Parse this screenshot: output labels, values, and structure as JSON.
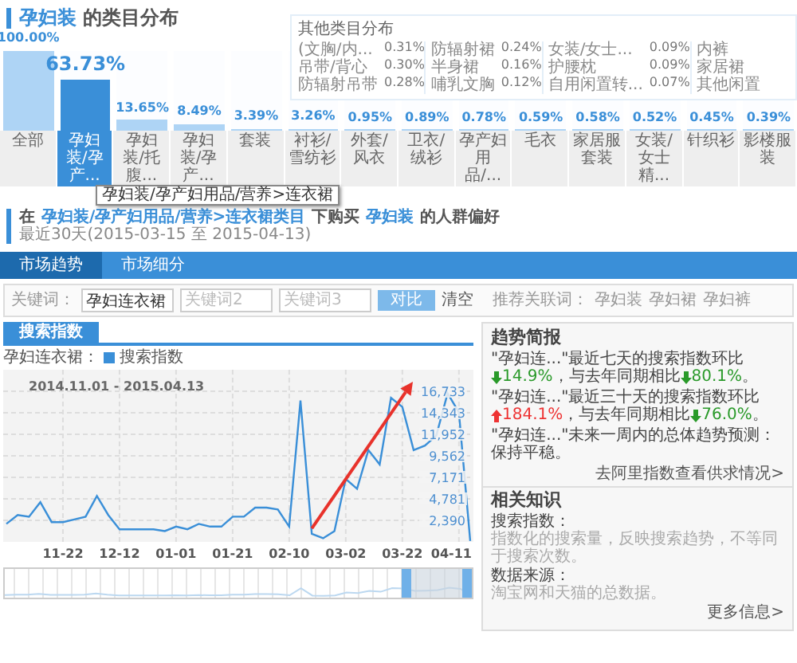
{
  "category_distribution": {
    "title_highlight": "孕妇装",
    "title_rest": "的类目分布",
    "other_categories": {
      "title": "其他类目分布",
      "columns": [
        {
          "items": [
            {
              "label": "(文胸/内...",
              "value": "0.31%"
            },
            {
              "label": "吊带/背心",
              "value": "0.30%"
            },
            {
              "label": "防辐射吊带",
              "value": "0.28%"
            }
          ]
        },
        {
          "items": [
            {
              "label": "防辐射裙",
              "value": "0.24%"
            },
            {
              "label": "半身裙",
              "value": "0.16%"
            },
            {
              "label": "哺乳文胸",
              "value": "0.12%"
            }
          ]
        },
        {
          "items": [
            {
              "label": "女装/女士...",
              "value": "0.09%"
            },
            {
              "label": "护腰枕",
              "value": "0.09%"
            },
            {
              "label": "自用闲置转...",
              "value": "0.07%"
            }
          ]
        },
        {
          "items": [
            {
              "label": "内裤"
            },
            {
              "label": "家居裙"
            },
            {
              "label": "其他闲置"
            }
          ]
        }
      ]
    },
    "bars": [
      {
        "value": "100.00%",
        "level": 1,
        "label": "全部",
        "selected": false
      },
      {
        "value": "63.73%",
        "level": 0.6373,
        "label": "孕妇装/孕产...",
        "selected": true
      },
      {
        "value": "13.65%",
        "level": 0.1365,
        "label": "孕妇装/托腹...",
        "selected": false
      },
      {
        "value": "8.49%",
        "level": 0.0849,
        "label": "孕妇装/孕产...",
        "selected": false
      },
      {
        "value": "3.39%",
        "level": 0.0339,
        "label": "套装",
        "selected": false
      },
      {
        "value": "3.26%",
        "level": 0.0326,
        "label": "衬衫/雪纺衫",
        "selected": false
      },
      {
        "value": "0.95%",
        "level": 0.0095,
        "label": "外套/风衣",
        "selected": false
      },
      {
        "value": "0.89%",
        "level": 0.0089,
        "label": "卫衣/绒衫",
        "selected": false
      },
      {
        "value": "0.78%",
        "level": 0.0078,
        "label": "孕产妇用品/...",
        "selected": false
      },
      {
        "value": "0.59%",
        "level": 0.0059,
        "label": "毛衣",
        "selected": false
      },
      {
        "value": "0.58%",
        "level": 0.0058,
        "label": "家居服套装",
        "selected": false
      },
      {
        "value": "0.52%",
        "level": 0.0052,
        "label": "女装/女士精...",
        "selected": false
      },
      {
        "value": "0.45%",
        "level": 0.0045,
        "label": "针织衫",
        "selected": false
      },
      {
        "value": "0.39%",
        "level": 0.0039,
        "label": "影楼服装",
        "selected": false
      }
    ],
    "tooltip": "孕妇装/孕产妇用品/营养>连衣裙"
  },
  "preference_heading": {
    "parts": [
      {
        "kind": "plain",
        "text": "在"
      },
      {
        "kind": "link",
        "text": "孕妇装/孕产妇用品/营养>连衣裙类目"
      },
      {
        "kind": "plain",
        "text": "下购买"
      },
      {
        "kind": "link",
        "text": "孕妇装"
      },
      {
        "kind": "plain",
        "text": "的人群偏好"
      }
    ],
    "period": "最近30天(2015-03-15 至 2015-04-13)"
  },
  "tabs": [
    {
      "label": "市场趋势",
      "selected": true
    },
    {
      "label": "市场细分",
      "selected": false
    }
  ],
  "keywords": {
    "label": "关键词：",
    "fields": [
      {
        "value": "孕妇连衣裙"
      },
      {
        "placeholder": "关键词2"
      },
      {
        "placeholder": "关键词3"
      }
    ],
    "compare_button": "对比",
    "clear_link": "清空",
    "related_label": "推荐关联词：",
    "related": [
      "孕妇装",
      "孕妇裙",
      "孕妇裤"
    ]
  },
  "chart_panel": {
    "tab": "搜索指数",
    "series_label": "孕妇连衣裙：",
    "date_range": "2014.11.01 - 2015.04.13",
    "chart_data": {
      "type": "line",
      "categories": [
        null,
        null,
        null,
        null,
        null,
        "11-22",
        null,
        null,
        null,
        null,
        "12-12",
        null,
        null,
        null,
        null,
        "01-01",
        null,
        null,
        null,
        null,
        "01-21",
        null,
        null,
        null,
        null,
        "02-10",
        null,
        null,
        null,
        null,
        "03-02",
        null,
        null,
        null,
        null,
        "03-22",
        null,
        null,
        null,
        null,
        "04-11",
        null
      ],
      "series": [
        {
          "name": "搜索指数",
          "color": "#3a8fd8",
          "values": [
            2000,
            3000,
            2800,
            4400,
            2200,
            2200,
            2500,
            2800,
            5100,
            3000,
            1400,
            1400,
            1400,
            1400,
            1200,
            1700,
            1400,
            2000,
            1700,
            1700,
            2800,
            2800,
            3800,
            3800,
            3600,
            1700,
            15700,
            900,
            400,
            1200,
            7000,
            5900,
            10200,
            8600,
            16000,
            15000,
            10200,
            10700,
            11800,
            16500,
            14400,
            100
          ]
        }
      ],
      "ylim": [
        0,
        19120
      ],
      "grid": true,
      "yticks": [
        {
          "value": 2390,
          "label": "2,390"
        },
        {
          "value": 4781,
          "label": "4,781"
        },
        {
          "value": 7171,
          "label": "7,171"
        },
        {
          "value": 9562,
          "label": "9,562"
        },
        {
          "value": 11952,
          "label": "11,952"
        },
        {
          "value": 14343,
          "label": "14,343"
        },
        {
          "value": 16733,
          "label": "16,733"
        }
      ]
    }
  },
  "trend_brief": {
    "title": "趋势简报",
    "items": [
      {
        "segments": [
          {
            "kind": "text",
            "text": "\"孕妇连...\"最近七天的搜索指数环比"
          },
          {
            "kind": "down",
            "text": "14.9%"
          },
          {
            "kind": "text",
            "text": "，与去年同期相比"
          },
          {
            "kind": "down",
            "text": "80.1%"
          },
          {
            "kind": "text",
            "text": "。"
          }
        ]
      },
      {
        "segments": [
          {
            "kind": "text",
            "text": "\"孕妇连...\"最近三十天的搜索指数环比"
          },
          {
            "kind": "up",
            "text": "184.1%"
          },
          {
            "kind": "text",
            "text": "，与去年同期相比"
          },
          {
            "kind": "down",
            "text": "76.0%"
          },
          {
            "kind": "text",
            "text": "。"
          }
        ]
      },
      {
        "segments": [
          {
            "kind": "text",
            "text": "\"孕妇连...\"未来一周内的总体趋势预测：保持平稳。"
          }
        ]
      }
    ],
    "link": "去阿里指数查看供求情况>"
  },
  "knowledge": {
    "title": "相关知识",
    "entries": [
      {
        "term": "搜索指数：",
        "desc": "指数化的搜索量，反映搜索趋势，不等同于搜索次数。"
      },
      {
        "term": "数据来源：",
        "desc": "淘宝网和天猫的总数据。"
      }
    ],
    "more": "更多信息>"
  }
}
